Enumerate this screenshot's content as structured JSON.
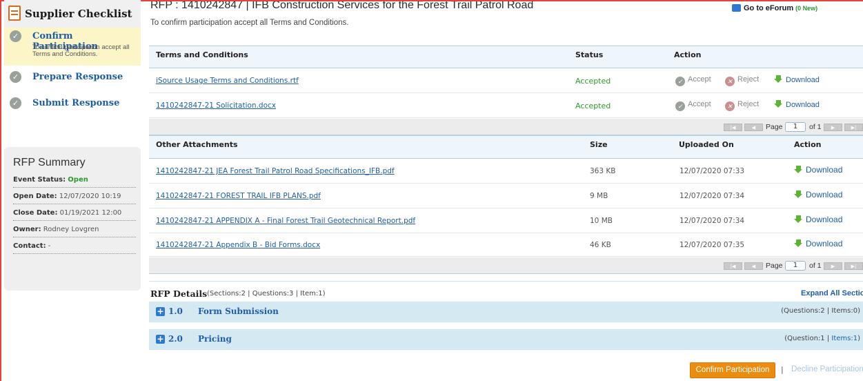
{
  "sidebar": {
    "title": "Supplier Checklist",
    "steps": [
      {
        "label": "Confirm Participation",
        "desc": "To confirm participation accept all Terms and Conditions."
      },
      {
        "label": "Prepare Response"
      },
      {
        "label": "Submit Response"
      }
    ],
    "summary": {
      "title": "RFP Summary",
      "event_status_label": "Event Status:",
      "event_status_value": "Open",
      "open_date_label": "Open Date:",
      "open_date_value": "12/07/2020 10:19",
      "close_date_label": "Close Date:",
      "close_date_value": "01/19/2021 12:00",
      "owner_label": "Owner:",
      "owner_value": "Rodney Lovgren",
      "contact_label": "Contact:",
      "contact_value": "-"
    }
  },
  "header": {
    "title": "RFP : 1410242847 | IFB Construction Services for the Forest Trail Patrol Road",
    "subtitle": "To confirm participation accept all Terms and Conditions.",
    "eforum_label": "Go to eForum",
    "eforum_new": "(0 New)"
  },
  "terms": {
    "headers": {
      "name": "Terms and Conditions",
      "status": "Status",
      "action": "Action"
    },
    "rows": [
      {
        "name": "iSource Usage Terms and Conditions.rtf",
        "status": "Accepted"
      },
      {
        "name": "1410242847-21 Solicitation.docx",
        "status": "Accepted"
      }
    ],
    "accept_label": "Accept",
    "reject_label": "Reject",
    "download_label": "Download"
  },
  "pager": {
    "page_label": "Page",
    "page_value": "1",
    "of_label": "of 1"
  },
  "attachments": {
    "headers": {
      "name": "Other Attachments",
      "size": "Size",
      "uploaded": "Uploaded On",
      "action": "Action"
    },
    "rows": [
      {
        "name": "1410242847-21 JEA Forest Trail Patrol Road Specifications_IFB.pdf",
        "size": "363 KB",
        "uploaded": "12/07/2020 07:33"
      },
      {
        "name": "1410242847-21 FOREST TRAIL IFB PLANS.pdf",
        "size": "9 MB",
        "uploaded": "12/07/2020 07:34"
      },
      {
        "name": "1410242847-21 APPENDIX A - Final Forest Trail Geotechnical Report.pdf",
        "size": "10 MB",
        "uploaded": "12/07/2020 07:34"
      },
      {
        "name": "1410242847-21 Appendix B - Bid Forms.docx",
        "size": "46 KB",
        "uploaded": "12/07/2020 07:35"
      }
    ],
    "download_label": "Download"
  },
  "details": {
    "title": "RFP Details",
    "meta": "(Sections:2 | Questions:3 | Item:1)",
    "expand_all": "Expand All Sections",
    "sections": [
      {
        "num": "1.0",
        "name": "Form Submission",
        "meta": "(Questions:2 | Items:0)"
      },
      {
        "num": "2.0",
        "name": "Pricing",
        "meta_prefix": "(Question:1 | ",
        "meta_link": "Items:1",
        "meta_suffix": ")"
      }
    ]
  },
  "footer": {
    "confirm_label": "Confirm Participation",
    "separator": "|",
    "decline_label": "Decline Participation"
  },
  "colors": {
    "accent_blue": "#1f5da8",
    "accepted_green": "#2c9a2c",
    "confirm_orange": "#eb8c0e"
  }
}
